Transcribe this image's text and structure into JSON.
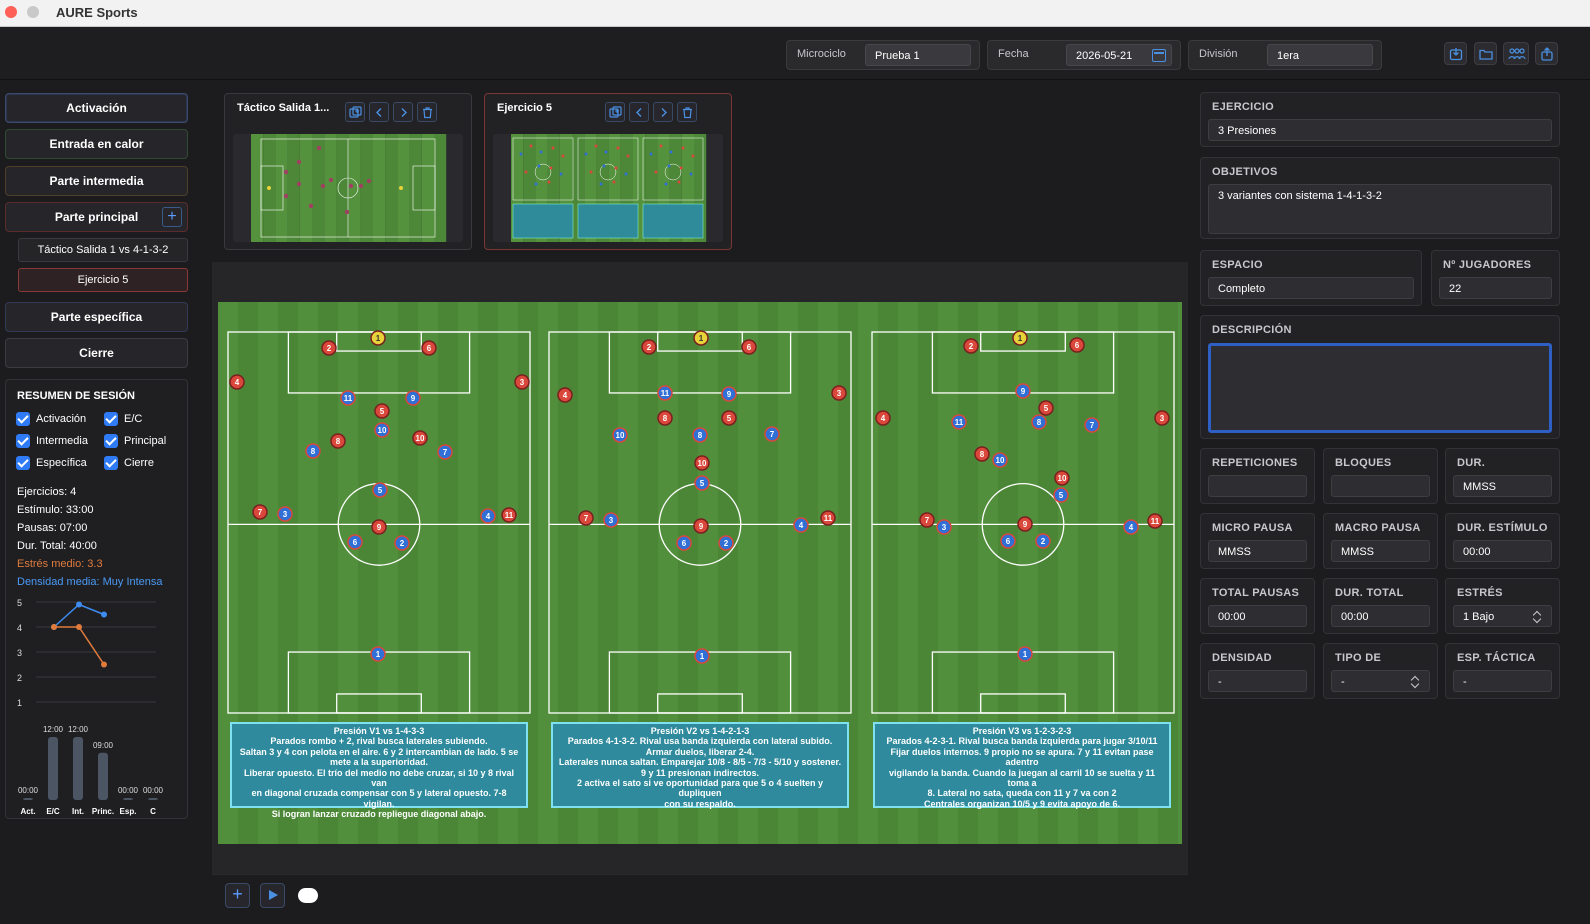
{
  "app": {
    "title": "AURE Sports"
  },
  "topbar": {
    "microciclo_label": "Microciclo",
    "microciclo_value": "Prueba 1",
    "fecha_label": "Fecha",
    "fecha_value": "2026-05-21",
    "division_label": "División",
    "division_value": "1era",
    "icons": [
      "export-icon",
      "folder-icon",
      "team-icon",
      "share-icon"
    ]
  },
  "sidebar": {
    "phases": [
      {
        "label": "Activación"
      },
      {
        "label": "Entrada en calor"
      },
      {
        "label": "Parte intermedia"
      },
      {
        "label": "Parte principal"
      },
      {
        "label": "Parte específica"
      },
      {
        "label": "Cierre"
      }
    ],
    "add_label": "+",
    "sub_items": [
      {
        "label": "Táctico Salida 1 vs 4-1-3-2"
      },
      {
        "label": "Ejercicio 5"
      }
    ],
    "summary": {
      "title": "RESUMEN DE SESIÓN",
      "checks": [
        "Activación",
        "E/C",
        "Intermedia",
        "Principal",
        "Específica",
        "Cierre"
      ],
      "ejercicios": "Ejercicios: 4",
      "estimulo": "Estímulo: 33:00",
      "pausas": "Pausas: 07:00",
      "dur_total": "Dur. Total: 40:00",
      "estres": "Estrés medio: 3.3",
      "densidad": "Densidad media: Muy Intensa"
    }
  },
  "chart_data": [
    {
      "type": "line",
      "y_ticks": [
        "5",
        "4",
        "3",
        "2",
        "1"
      ],
      "ylim": [
        1,
        5
      ],
      "series": [
        {
          "color": "#3d8cf0",
          "values": [
            4,
            4.9,
            4.5
          ]
        },
        {
          "color": "#e07b3c",
          "values": [
            4,
            4,
            2.5
          ]
        }
      ]
    },
    {
      "type": "bar",
      "categories": [
        "Act.",
        "E/C",
        "Int.",
        "Princ.",
        "Esp.",
        "C"
      ],
      "values": [
        0,
        12,
        12,
        9,
        0,
        0
      ],
      "value_labels": [
        "00:00",
        "12:00",
        "12:00",
        "09:00",
        "00:00",
        "00:00"
      ]
    }
  ],
  "exercise_cards": [
    {
      "title": "Táctico Salida 1..."
    },
    {
      "title": "Ejercicio 5"
    }
  ],
  "boards": [
    {
      "title": "Presión V1 vs 1-4-3-3",
      "lines": [
        "Parados rombo + 2, rival busca laterales subiendo.",
        "Saltan 3 y 4 con pelota en el aire. 6 y 2 intercambian de lado. 5 se",
        "mete a la superioridad.",
        "Liberar opuesto. El trío del medio no debe cruzar, si 10 y 8 rival van",
        "en diagonal cruzada compensar con 5 y lateral opuesto. 7-8 vigilan.",
        "Si logran lanzar cruzado repliegue diagonal abajo."
      ]
    },
    {
      "title": "Presión V2 vs 1-4-2-1-3",
      "lines": [
        "Parados 4-1-3-2. Rival usa banda izquierda con lateral subido.",
        "Armar duelos, liberar 2-4.",
        "Laterales nunca saltan. Emparejar 10/8 - 8/5 - 7/3 - 5/10 y sostener.",
        "9 y 11 presionan indirectos.",
        "2 activa el sato si ve oportunidad para que 5 o 4 suelten y dupliquen",
        "con su respaldo."
      ]
    },
    {
      "title": "Presión V3 vs 1-2-3-2-3",
      "lines": [
        "Parados 4-2-3-1. Rival busca banda izquierda para jugar 3/10/11",
        "Fijar duelos internos. 9 propio no se apura. 7 y 11 evitan pase adentro",
        "vigilando la banda. Cuando la juegan al carril 10 se suelta y 11 toma a",
        "8. Lateral no sata, queda con 11 y 7 va con 2",
        "Centrales organizan 10/5 y 9 evita apoyo de 6."
      ]
    }
  ],
  "right_panel": {
    "ejercicio_label": "EJERCICIO",
    "ejercicio_value": "3 Presiones",
    "objetivos_label": "OBJETIVOS",
    "objetivos_value": "3 variantes con sistema 1-4-1-3-2",
    "espacio_label": "ESPACIO",
    "espacio_value": "Completo",
    "jugadores_label": "Nº JUGADORES",
    "jugadores_value": "22",
    "descripcion_label": "DESCRIPCIÓN",
    "descripcion_value": "",
    "repeticiones_label": "REPETICIONES",
    "repeticiones_value": "",
    "bloques_label": "BLOQUES",
    "bloques_value": "",
    "dur_label": "DUR.",
    "dur_value": "MMSS",
    "micro_label": "MICRO PAUSA",
    "micro_value": "MMSS",
    "macro_label": "MACRO PAUSA",
    "macro_value": "MMSS",
    "dur_estimulo_label": "DUR. ESTÍMULO",
    "dur_estimulo_value": "00:00",
    "total_pausas_label": "TOTAL PAUSAS",
    "total_pausas_value": "00:00",
    "dur_total_label": "DUR. TOTAL",
    "dur_total_value": "00:00",
    "estres_label": "ESTRÉS",
    "estres_value": "1 Bajo",
    "densidad_label": "DENSIDAD",
    "densidad_value": "-",
    "tipo_label": "TIPO DE",
    "tipo_value": "-",
    "esp_tactica_label": "ESP. TÁCTICA",
    "esp_tactica_value": "-"
  },
  "colors": {
    "red_team": "#d9483b",
    "blue_team": "#2f6fd6",
    "goalkeeper": "#e8d23a",
    "accent": "#2f7bf5"
  }
}
